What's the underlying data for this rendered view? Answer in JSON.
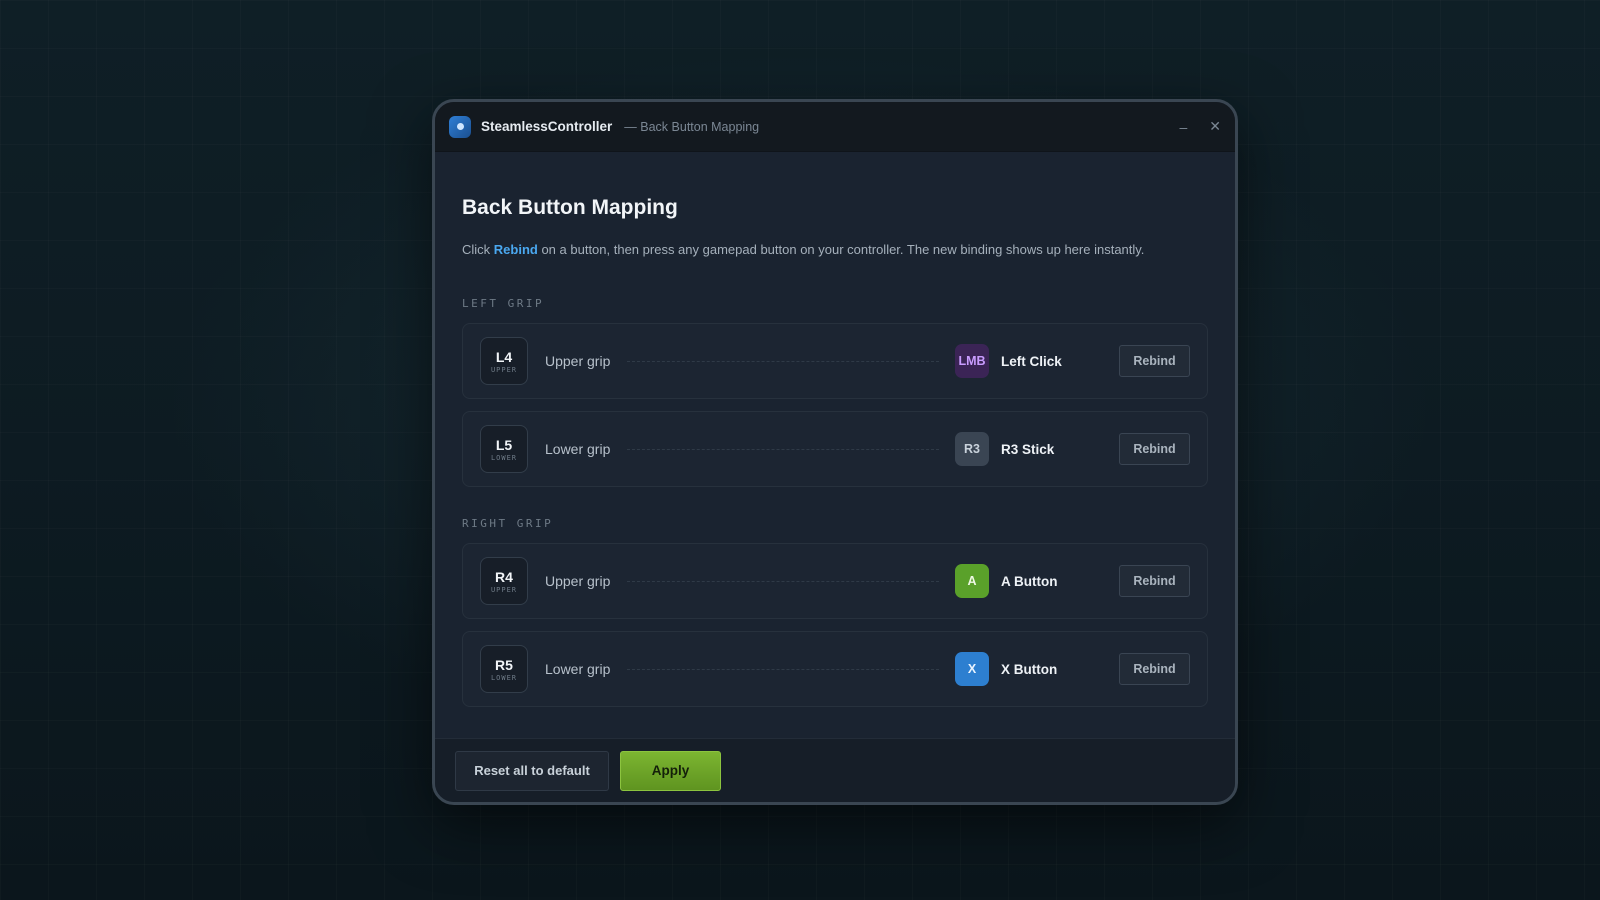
{
  "window": {
    "app_name": "SteamlessController",
    "subtitle": "— Back Button Mapping",
    "minimize_glyph": "–",
    "close_glyph": "✕"
  },
  "page": {
    "title": "Back Button Mapping",
    "desc_prefix": "Click ",
    "desc_highlight": "Rebind",
    "desc_suffix": " on a button, then press any gamepad button on your controller. The new binding shows up here instantly."
  },
  "sections": [
    {
      "label": "LEFT GRIP",
      "rows": [
        {
          "key": "L4",
          "key_sub": "UPPER",
          "grip": "Upper grip",
          "binding_badge": "LMB",
          "binding_name": "Left Click",
          "badge_bg": "#3b2456",
          "badge_fg": "#c99cff",
          "rebind": "Rebind"
        },
        {
          "key": "L5",
          "key_sub": "LOWER",
          "grip": "Lower grip",
          "binding_badge": "R3",
          "binding_name": "R3 Stick",
          "badge_bg": "#3a4553",
          "badge_fg": "#c9d2db",
          "rebind": "Rebind"
        }
      ]
    },
    {
      "label": "RIGHT GRIP",
      "rows": [
        {
          "key": "R4",
          "key_sub": "UPPER",
          "grip": "Upper grip",
          "binding_badge": "A",
          "binding_name": "A Button",
          "badge_bg": "#5aa12a",
          "badge_fg": "#eef8e4",
          "rebind": "Rebind"
        },
        {
          "key": "R5",
          "key_sub": "LOWER",
          "grip": "Lower grip",
          "binding_badge": "X",
          "binding_name": "X Button",
          "badge_bg": "#2d7fd0",
          "badge_fg": "#eaf4ff",
          "rebind": "Rebind"
        }
      ]
    }
  ],
  "footer": {
    "reset_label": "Reset all to default",
    "apply_label": "Apply"
  }
}
